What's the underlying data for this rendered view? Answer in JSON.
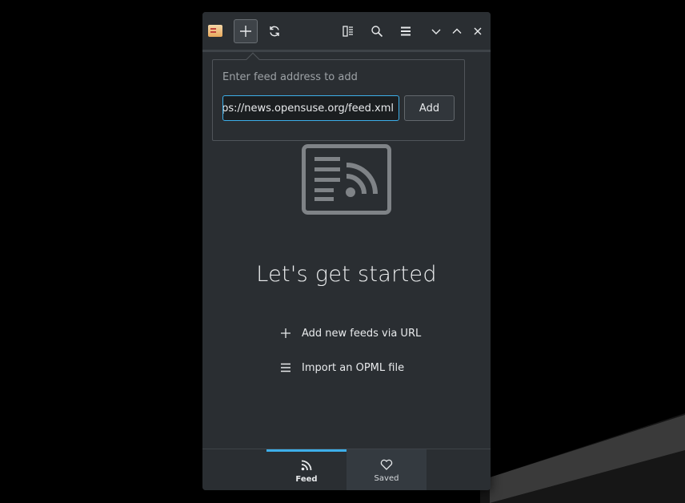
{
  "toolbar": {
    "buttons": [
      "app-icon",
      "add-icon",
      "refresh-icon",
      "view-icon",
      "search-icon",
      "menu-icon",
      "minimize-icon",
      "maximize-icon",
      "close-icon"
    ]
  },
  "popup": {
    "label": "Enter feed address to add",
    "url_value": "https://news.opensuse.org/feed.xml",
    "add_label": "Add"
  },
  "main": {
    "headline": "Let's get started",
    "actions": [
      {
        "icon": "plus-icon",
        "label": "Add new feeds via URL"
      },
      {
        "icon": "menu-lines-icon",
        "label": "Import an OPML file"
      }
    ]
  },
  "tabs": [
    {
      "icon": "rss-icon",
      "label": "Feed",
      "active": true
    },
    {
      "icon": "heart-icon",
      "label": "Saved",
      "active": false
    }
  ],
  "colors": {
    "accent": "#3daee9",
    "window_bg": "#2a2e32",
    "text": "#e8eaec"
  }
}
